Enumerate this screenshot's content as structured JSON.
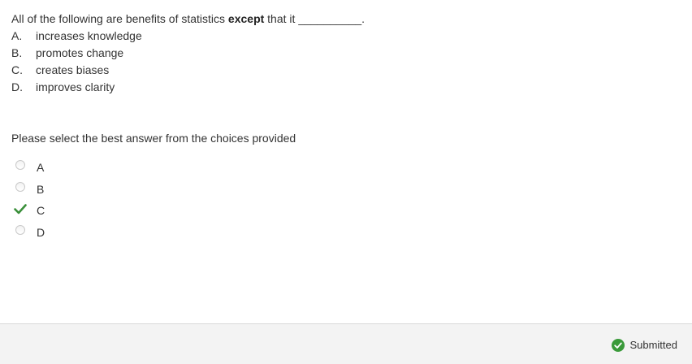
{
  "question": {
    "stem_before": "All of the following are benefits of statistics ",
    "stem_bold": "except",
    "stem_after": " that it ",
    "stem_blank": "__________.",
    "options": [
      {
        "letter": "A.",
        "text": "increases knowledge"
      },
      {
        "letter": "B.",
        "text": "promotes change"
      },
      {
        "letter": "C.",
        "text": "creates biases"
      },
      {
        "letter": "D.",
        "text": "improves clarity"
      }
    ]
  },
  "prompt": "Please select the best answer from the choices provided",
  "choices": [
    {
      "label": "A",
      "state": "unselected"
    },
    {
      "label": "B",
      "state": "unselected"
    },
    {
      "label": "C",
      "state": "correct"
    },
    {
      "label": "D",
      "state": "unselected"
    }
  ],
  "footer": {
    "status_text": "Submitted",
    "status_icon": "check-circle-icon"
  },
  "colors": {
    "correct_green": "#3a8f3a",
    "text": "#333333",
    "footer_bg": "#f3f3f3"
  }
}
